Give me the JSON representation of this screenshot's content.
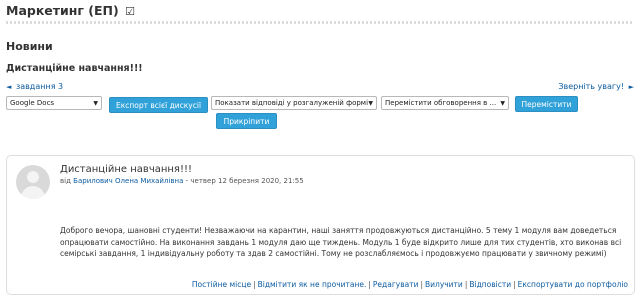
{
  "course": {
    "title": "Маркетинг (ЕП)",
    "check_icon": "☑"
  },
  "forum": {
    "title": "Новини"
  },
  "discussion": {
    "title": "Дистанційне навчання!!!"
  },
  "nav": {
    "prev_label": "завдання 3",
    "next_label": "Зверніть увагу!"
  },
  "controls": {
    "format_select": "Google Docs",
    "export_button": "Експорт всієї дискусії",
    "display_mode_select": "Показати відповіді у розгалуженій формі",
    "move_select": "Перемістити обговорення в ...",
    "move_button": "Перемістити",
    "pin_button": "Прикріпити"
  },
  "post": {
    "subject": "Дистанційне навчання!!!",
    "by_prefix": "від",
    "author": "Барилович Олена Михайлівна",
    "date": " - четвер 12 березня 2020, 21:55",
    "body": "Доброго вечора, шановні студенти! Незважаючи на карантин, наші заняття продовжуються дистанційно. 5 тему 1 модуля вам доведеться опрацювати самостійно. На виконання завдань 1 модуля даю ще тиждень. Модуль 1 буде відкрито лише для тих студентів, хто виконав всі семірські завдання, 1 індивідуальну роботу та здав 2 самостійні. Тому не розслабляємось і продовжуємо працювати у звичному режимі)",
    "actions": {
      "permalink": "Постійне місце",
      "mark_unread": "Відмітити як не прочитане.",
      "edit": "Редагувати",
      "delete": "Вилучити",
      "reply": "Відповісти",
      "export_portfolio": "Експортувати до портфоліо"
    }
  },
  "colors": {
    "accent_button": "#31a2d9",
    "link": "#0d5ca1"
  }
}
